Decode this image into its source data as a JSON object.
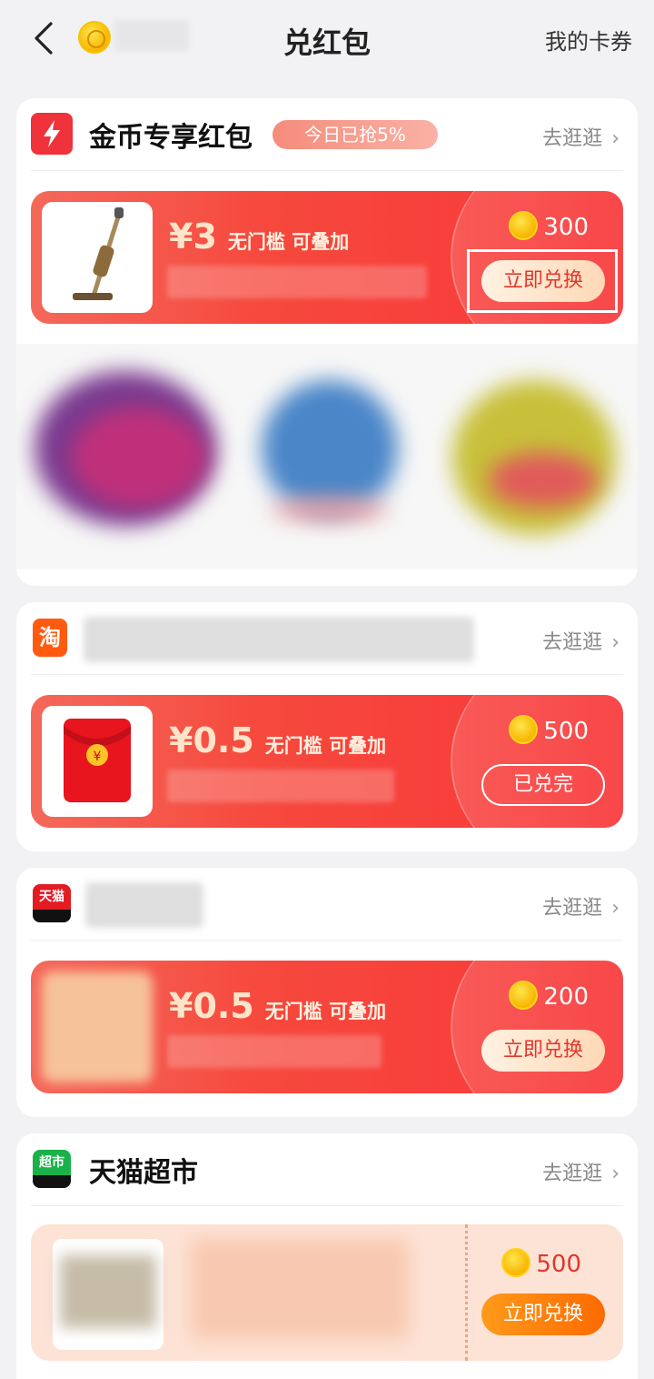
{
  "header": {
    "title": "兑红包",
    "right_link": "我的卡券"
  },
  "sections": [
    {
      "name": "金币专享红包",
      "badge": "今日已抢5%",
      "goto": "去逛逛",
      "coupon": {
        "amount": "¥3",
        "desc": "无门槛 可叠加",
        "coins": "300",
        "button": "立即兑换"
      }
    },
    {
      "name": "",
      "logo_text": "淘",
      "goto": "去逛逛",
      "coupon": {
        "amount": "¥0.5",
        "desc": "无门槛 可叠加",
        "coins": "500",
        "button": "已兑完"
      }
    },
    {
      "name": "",
      "logo_text": "天猫",
      "goto": "去逛逛",
      "coupon": {
        "amount": "¥0.5",
        "desc": "无门槛 可叠加",
        "coins": "200",
        "button": "立即兑换"
      }
    },
    {
      "name": "天猫超市",
      "logo_text": "超市",
      "goto": "去逛逛",
      "coupon": {
        "coins": "500",
        "button": "立即兑换"
      }
    }
  ],
  "colors": {
    "accent_red": "#f6483d",
    "coin_gold": "#f7b500",
    "page_bg": "#f2f2f4"
  }
}
